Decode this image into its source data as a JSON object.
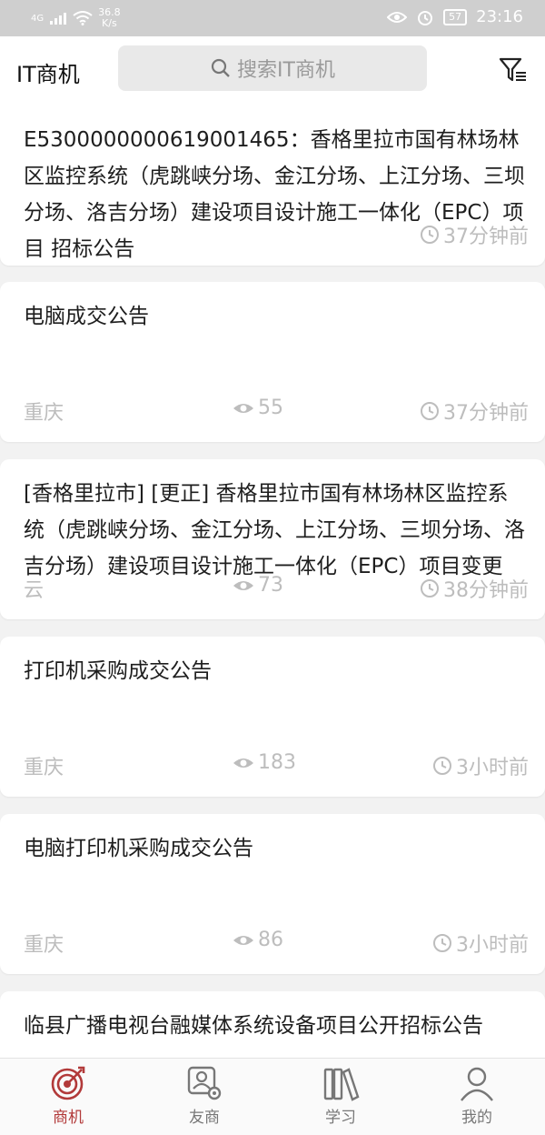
{
  "status_bar": {
    "signal": "4G",
    "net_speed_value": "36.8",
    "net_speed_unit": "K/s",
    "battery": "57",
    "time": "23:16"
  },
  "header": {
    "title": "IT商机",
    "search_placeholder": "搜索IT商机"
  },
  "items": [
    {
      "title": "E5300000000619001465：香格里拉市国有林场林区监控系统（虎跳峡分场、金江分场、上江分场、三坝分场、洛吉分场）建设项目设计施工一体化（EPC）项目 招标公告",
      "region": "",
      "views": "",
      "time": "37分钟前"
    },
    {
      "title": "电脑成交公告",
      "region": "重庆",
      "views": "55",
      "time": "37分钟前"
    },
    {
      "title": "[香格里拉市] [更正] 香格里拉市国有林场林区监控系统（虎跳峡分场、金江分场、上江分场、三坝分场、洛吉分场）建设项目设计施工一体化（EPC）项目变更",
      "region": "云",
      "views": "73",
      "time": "38分钟前"
    },
    {
      "title": "打印机采购成交公告",
      "region": "重庆",
      "views": "183",
      "time": "3小时前"
    },
    {
      "title": "电脑打印机采购成交公告",
      "region": "重庆",
      "views": "86",
      "time": "3小时前"
    },
    {
      "title": "临县广播电视台融媒体系统设备项目公开招标公告",
      "region": "",
      "views": "",
      "time": ""
    }
  ],
  "bottom_nav": [
    {
      "label": "商机",
      "icon": "target-icon",
      "active": true
    },
    {
      "label": "友商",
      "icon": "contact-settings-icon",
      "active": false
    },
    {
      "label": "学习",
      "icon": "books-icon",
      "active": false
    },
    {
      "label": "我的",
      "icon": "person-icon",
      "active": false
    }
  ],
  "colors": {
    "accent": "#b23a3a",
    "meta_text": "#bdbdbd",
    "status_bar_bg": "#cfcfcf"
  }
}
